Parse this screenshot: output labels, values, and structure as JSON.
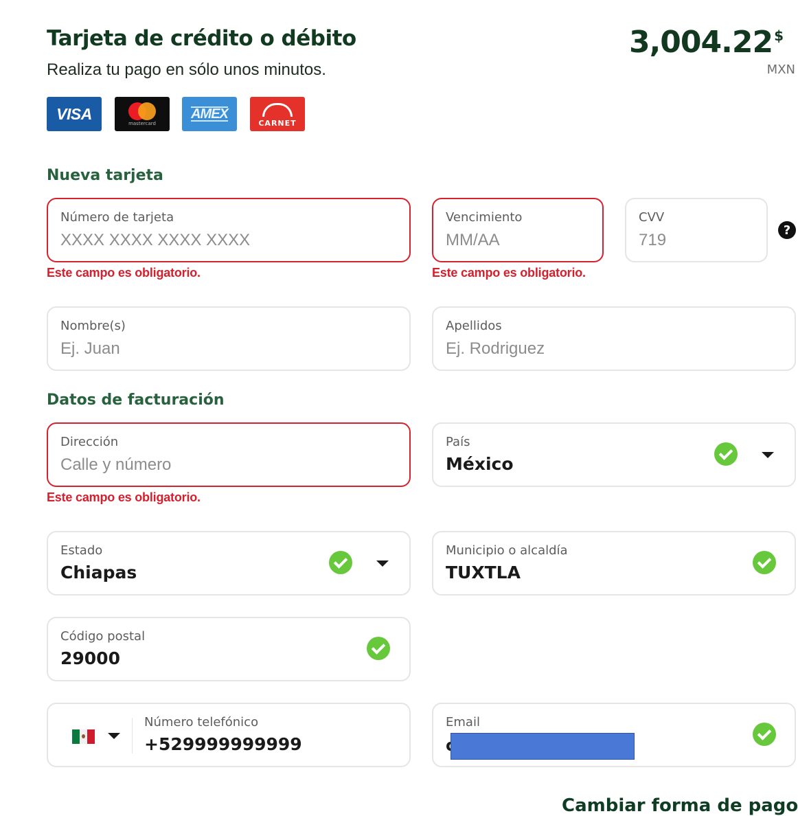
{
  "header": {
    "title": "Tarjeta de crédito o débito",
    "subtitle": "Realiza tu pago en sólo unos minutos.",
    "amount": "3,004.22",
    "amount_symbol": "$",
    "currency": "MXN"
  },
  "card_brands": {
    "visa": "VISA",
    "mastercard": "mastercard",
    "amex": "AMEX",
    "carnet": "CARNET"
  },
  "new_card": {
    "section_title": "Nueva tarjeta",
    "card_number": {
      "label": "Número de tarjeta",
      "placeholder": "XXXX XXXX XXXX XXXX",
      "error": "Este campo es obligatorio."
    },
    "expiry": {
      "label": "Vencimiento",
      "placeholder": "MM/AA",
      "error": "Este campo es obligatorio."
    },
    "cvv": {
      "label": "CVV",
      "placeholder": "719",
      "help_icon": "?"
    },
    "first_name": {
      "label": "Nombre(s)",
      "placeholder": "Ej. Juan"
    },
    "last_name": {
      "label": "Apellidos",
      "placeholder": "Ej. Rodriguez"
    }
  },
  "billing": {
    "section_title": "Datos de facturación",
    "address": {
      "label": "Dirección",
      "placeholder": "Calle y número",
      "error": "Este campo es obligatorio."
    },
    "country": {
      "label": "País",
      "value": "México"
    },
    "state": {
      "label": "Estado",
      "value": "Chiapas"
    },
    "municipality": {
      "label": "Municipio o alcaldía",
      "value": "TUXTLA"
    },
    "postal_code": {
      "label": "Código postal",
      "value": "29000"
    },
    "phone": {
      "label": "Número telefónico",
      "value": "+529999999999"
    },
    "email": {
      "label": "Email",
      "value_visible": "c"
    }
  },
  "footer": {
    "link": "Cambiar forma de pago"
  },
  "colors": {
    "brand_green": "#123a21",
    "section_green": "#27613d",
    "error_red": "#d6222f",
    "check_green": "#68c83c"
  }
}
